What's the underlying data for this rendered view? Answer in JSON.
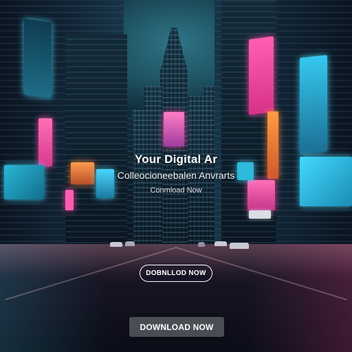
{
  "hero": {
    "title": "Your Digital Ar",
    "subtitle": "Colleocioneebalen Anvrarts",
    "small_cta": "Conmload Now"
  },
  "buttons": {
    "outline_label": "DOBNLLOD NOW",
    "primary_label": "DOWNLOAD NOW"
  },
  "scene": {
    "icons": [
      "city-skyline-illustration",
      "neon-billboard",
      "wet-street",
      "car"
    ],
    "colors": {
      "sky": "#143a48",
      "neon_pink": "#ff4fa8",
      "neon_cyan": "#42d9ff",
      "neon_orange": "#ff8a3c",
      "button_fill": "#4b4d54",
      "text": "#ffffff"
    }
  }
}
